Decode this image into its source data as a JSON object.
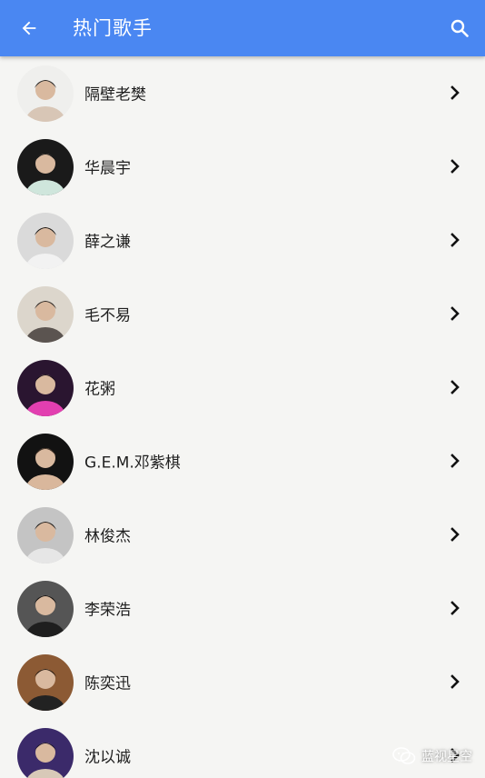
{
  "header": {
    "title": "热门歌手",
    "back_icon": "arrow-left-icon",
    "search_icon": "search-icon",
    "bar_color": "#4a87f2"
  },
  "singers": [
    {
      "name": "隔壁老樊",
      "avatar": {
        "bg": "#efefed",
        "fg": "#d8c6b6",
        "hair": "#2a2a2a"
      }
    },
    {
      "name": "华晨宇",
      "avatar": {
        "bg": "#1a1a1a",
        "fg": "#cfe6dc",
        "hair": "#1b1b1b"
      }
    },
    {
      "name": "薛之谦",
      "avatar": {
        "bg": "#dadada",
        "fg": "#f2f2f2",
        "hair": "#141414"
      }
    },
    {
      "name": "毛不易",
      "avatar": {
        "bg": "#dcd6cc",
        "fg": "#5b5450",
        "hair": "#2e2a27"
      }
    },
    {
      "name": "花粥",
      "avatar": {
        "bg": "#2a1530",
        "fg": "#e23fb0",
        "hair": "#1a0f1c"
      }
    },
    {
      "name": "G.E.M.邓紫棋",
      "avatar": {
        "bg": "#121212",
        "fg": "#d9b79c",
        "hair": "#3a2c22"
      }
    },
    {
      "name": "林俊杰",
      "avatar": {
        "bg": "#c4c4c4",
        "fg": "#e6e6e6",
        "hair": "#1e1e1e"
      }
    },
    {
      "name": "李荣浩",
      "avatar": {
        "bg": "#555555",
        "fg": "#1e1e1e",
        "hair": "#101010"
      }
    },
    {
      "name": "陈奕迅",
      "avatar": {
        "bg": "#8c5a34",
        "fg": "#222222",
        "hair": "#2c1c10"
      }
    },
    {
      "name": "沈以诚",
      "avatar": {
        "bg": "#3b2a6a",
        "fg": "#d8c9b8",
        "hair": "#1d1530"
      }
    }
  ],
  "chevron_icon": "chevron-right-icon",
  "watermark": {
    "text": "蓝视星空",
    "icon": "wechat-icon"
  }
}
